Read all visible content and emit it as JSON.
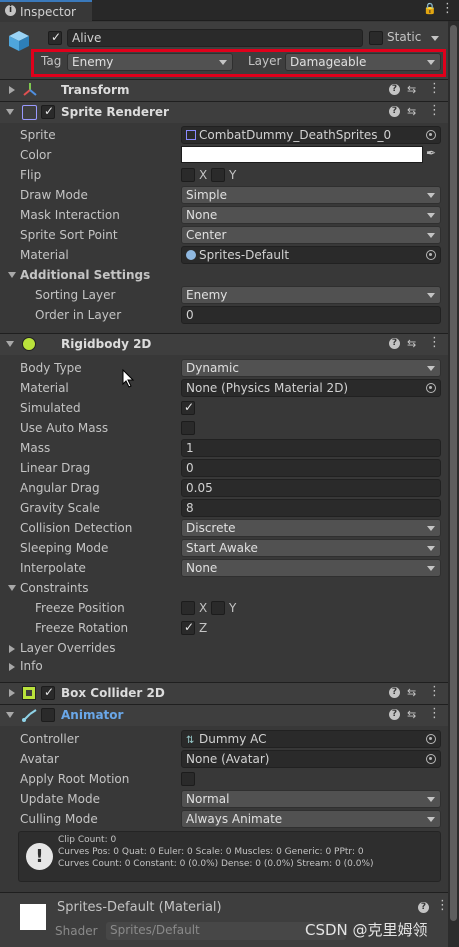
{
  "tab": {
    "title": "Inspector"
  },
  "gameobject": {
    "name": "Alive",
    "static_label": "Static",
    "tag_label": "Tag",
    "tag_value": "Enemy",
    "layer_label": "Layer",
    "layer_value": "Damageable"
  },
  "transform": {
    "title": "Transform"
  },
  "sprite_renderer": {
    "title": "Sprite Renderer",
    "sprite_label": "Sprite",
    "sprite_value": "CombatDummy_DeathSprites_0",
    "color_label": "Color",
    "flip_label": "Flip",
    "flip_x": "X",
    "flip_y": "Y",
    "draw_mode_label": "Draw Mode",
    "draw_mode_value": "Simple",
    "mask_label": "Mask Interaction",
    "mask_value": "None",
    "sort_point_label": "Sprite Sort Point",
    "sort_point_value": "Center",
    "material_label": "Material",
    "material_value": "Sprites-Default",
    "additional_label": "Additional Settings",
    "sorting_layer_label": "Sorting Layer",
    "sorting_layer_value": "Enemy",
    "order_label": "Order in Layer",
    "order_value": "0"
  },
  "rigidbody": {
    "title": "Rigidbody 2D",
    "body_type_label": "Body Type",
    "body_type_value": "Dynamic",
    "material_label": "Material",
    "material_value": "None (Physics Material 2D)",
    "simulated_label": "Simulated",
    "auto_mass_label": "Use Auto Mass",
    "mass_label": "Mass",
    "mass_value": "1",
    "linear_drag_label": "Linear Drag",
    "linear_drag_value": "0",
    "angular_drag_label": "Angular Drag",
    "angular_drag_value": "0.05",
    "gravity_label": "Gravity Scale",
    "gravity_value": "8",
    "collision_label": "Collision Detection",
    "collision_value": "Discrete",
    "sleeping_label": "Sleeping Mode",
    "sleeping_value": "Start Awake",
    "interpolate_label": "Interpolate",
    "interpolate_value": "None",
    "constraints_label": "Constraints",
    "freeze_pos_label": "Freeze Position",
    "freeze_x": "X",
    "freeze_y": "Y",
    "freeze_rot_label": "Freeze Rotation",
    "freeze_z": "Z",
    "layer_overrides_label": "Layer Overrides",
    "info_label": "Info"
  },
  "box_collider": {
    "title": "Box Collider 2D"
  },
  "animator": {
    "title": "Animator",
    "controller_label": "Controller",
    "controller_value": "Dummy AC",
    "avatar_label": "Avatar",
    "avatar_value": "None (Avatar)",
    "root_motion_label": "Apply Root Motion",
    "update_label": "Update Mode",
    "update_value": "Normal",
    "culling_label": "Culling Mode",
    "culling_value": "Always Animate",
    "info_line1": "Clip Count: 0",
    "info_line2": "Curves Pos: 0 Quat: 0 Euler: 0 Scale: 0 Muscles: 0 Generic: 0 PPtr: 0",
    "info_line3": "Curves Count: 0 Constant: 0 (0.0%) Dense: 0 (0.0%) Stream: 0 (0.0%)"
  },
  "material_footer": {
    "title": "Sprites-Default (Material)",
    "shader_label": "Shader",
    "shader_value": "Sprites/Default"
  },
  "watermark": "CSDN @克里姆领",
  "colors": {
    "highlight_box": "#e0001b",
    "accent": "#3a79bb",
    "animator_title": "#6aa7e8"
  }
}
